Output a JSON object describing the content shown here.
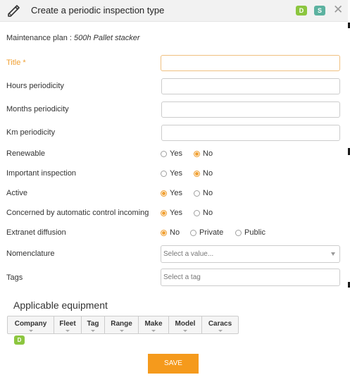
{
  "dialog": {
    "title": "Create a periodic inspection type",
    "badges": {
      "d": "D",
      "s": "S"
    },
    "close_glyph": "✕",
    "icon": "pencil-icon"
  },
  "plan": {
    "label": "Maintenance plan : ",
    "value": "500h Pallet stacker"
  },
  "fields": {
    "title": {
      "label": "Title *",
      "value": ""
    },
    "hours": {
      "label": "Hours periodicity",
      "value": ""
    },
    "months": {
      "label": "Months periodicity",
      "value": ""
    },
    "km": {
      "label": "Km periodicity",
      "value": ""
    }
  },
  "radios": {
    "renewable": {
      "label": "Renewable",
      "options": [
        "Yes",
        "No"
      ],
      "selected": "No"
    },
    "important": {
      "label": "Important inspection",
      "options": [
        "Yes",
        "No"
      ],
      "selected": "No"
    },
    "active": {
      "label": "Active",
      "options": [
        "Yes",
        "No"
      ],
      "selected": "Yes"
    },
    "auto_control": {
      "label": "Concerned by automatic control incoming",
      "options": [
        "Yes",
        "No"
      ],
      "selected": "Yes"
    },
    "extranet": {
      "label": "Extranet diffusion",
      "options": [
        "No",
        "Private",
        "Public"
      ],
      "selected": "No"
    }
  },
  "nomenclature": {
    "label": "Nomenclature",
    "placeholder": "Select a value..."
  },
  "tags": {
    "label": "Tags",
    "placeholder": "Select a tag"
  },
  "equipment": {
    "title": "Applicable equipment",
    "columns": [
      "Company",
      "Fleet",
      "Tag",
      "Range",
      "Make",
      "Model",
      "Caracs"
    ],
    "badge": "D"
  },
  "actions": {
    "save": "SAVE"
  },
  "colors": {
    "accent": "#f59a1c",
    "required": "#f0a033",
    "badge_d": "#8cc63f",
    "badge_s": "#5cb2a0"
  }
}
